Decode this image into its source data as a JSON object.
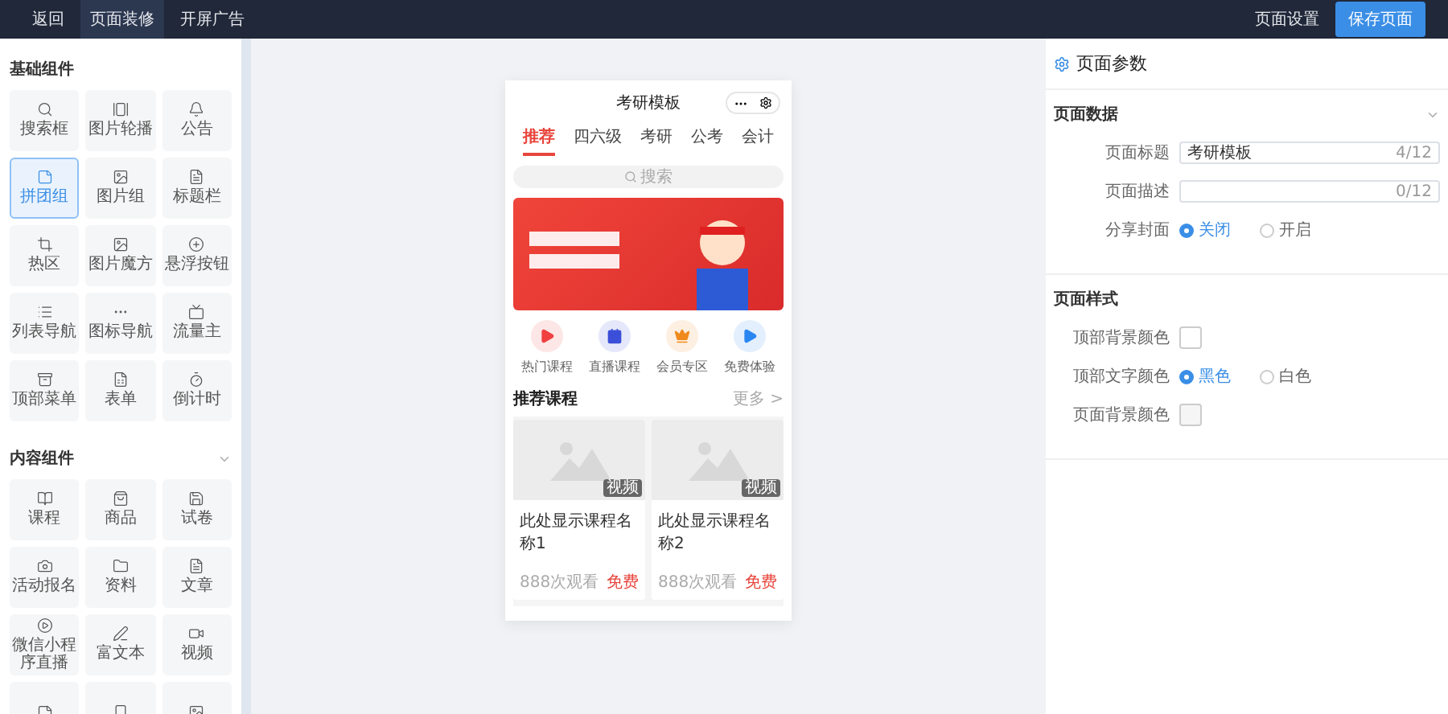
{
  "topbar": {
    "left": [
      {
        "label": "返回",
        "selected": false
      },
      {
        "label": "页面装修",
        "selected": true
      },
      {
        "label": "开屏广告",
        "selected": false
      }
    ],
    "settings": "页面设置",
    "save": "保存页面"
  },
  "sidebar": {
    "groups": [
      {
        "title": "基础组件",
        "items": [
          {
            "label": "搜索框",
            "selected": false
          },
          {
            "label": "图片轮播",
            "selected": false
          },
          {
            "label": "公告",
            "selected": false
          },
          {
            "label": "拼团组",
            "selected": true
          },
          {
            "label": "图片组",
            "selected": false
          },
          {
            "label": "标题栏",
            "selected": false
          },
          {
            "label": "热区",
            "selected": false
          },
          {
            "label": "图片魔方",
            "selected": false
          },
          {
            "label": "悬浮按钮",
            "selected": false
          },
          {
            "label": "列表导航",
            "selected": false
          },
          {
            "label": "图标导航",
            "selected": false
          },
          {
            "label": "流量主",
            "selected": false
          },
          {
            "label": "顶部菜单",
            "selected": false
          },
          {
            "label": "表单",
            "selected": false
          },
          {
            "label": "倒计时",
            "selected": false
          }
        ]
      },
      {
        "title": "内容组件",
        "items": [
          {
            "label": "课程",
            "selected": false
          },
          {
            "label": "商品",
            "selected": false
          },
          {
            "label": "试卷",
            "selected": false
          },
          {
            "label": "活动报名",
            "selected": false
          },
          {
            "label": "资料",
            "selected": false
          },
          {
            "label": "文章",
            "selected": false
          },
          {
            "label": "微信小程序直播",
            "selected": false
          },
          {
            "label": "富文本",
            "selected": false
          },
          {
            "label": "视频",
            "selected": false
          },
          {
            "selected": false
          },
          {
            "selected": false
          },
          {
            "selected": false
          }
        ]
      }
    ]
  },
  "phone": {
    "title": "考研模板",
    "tabs": [
      {
        "label": "推荐",
        "selected": true
      },
      {
        "label": "四六级",
        "selected": false
      },
      {
        "label": "考研",
        "selected": false
      },
      {
        "label": "公考",
        "selected": false
      },
      {
        "label": "会计",
        "selected": false
      }
    ],
    "search": {
      "placeholder": "搜索"
    },
    "nav": [
      {
        "label": "热门课程",
        "color": "#f04040"
      },
      {
        "label": "直播课程",
        "color": "#3b4fd8"
      },
      {
        "label": "会员专区",
        "color": "#f08a1c"
      },
      {
        "label": "免费体验",
        "color": "#2a86f0"
      }
    ],
    "section": {
      "title": "推荐课程",
      "more": "更多 >"
    },
    "courses": [
      {
        "badge": "视频",
        "name": "此处显示课程名称1",
        "views": "888次观看",
        "price": "免费"
      },
      {
        "badge": "视频",
        "name": "此处显示课程名称2",
        "views": "888次观看",
        "price": "免费"
      }
    ]
  },
  "panel": {
    "title": "页面参数",
    "sections": [
      {
        "title": "页面数据",
        "rows": [
          {
            "kind": "input",
            "label": "页面标题",
            "value": "考研模板",
            "count": "4/12"
          },
          {
            "kind": "input",
            "label": "页面描述",
            "count": "0/12"
          },
          {
            "kind": "radio",
            "label": "分享封面",
            "options": [
              {
                "label": "关闭",
                "selected": true
              },
              {
                "label": "开启",
                "selected": false
              }
            ]
          }
        ]
      },
      {
        "title": "页面样式",
        "rows": [
          {
            "kind": "color",
            "label": "顶部背景颜色",
            "color": "#ffffff"
          },
          {
            "kind": "radio",
            "label": "顶部文字颜色",
            "options": [
              {
                "label": "黑色",
                "selected": true
              },
              {
                "label": "白色",
                "selected": false
              }
            ]
          },
          {
            "kind": "color",
            "label": "页面背景颜色",
            "color": "#f5f5f5"
          }
        ]
      }
    ]
  }
}
